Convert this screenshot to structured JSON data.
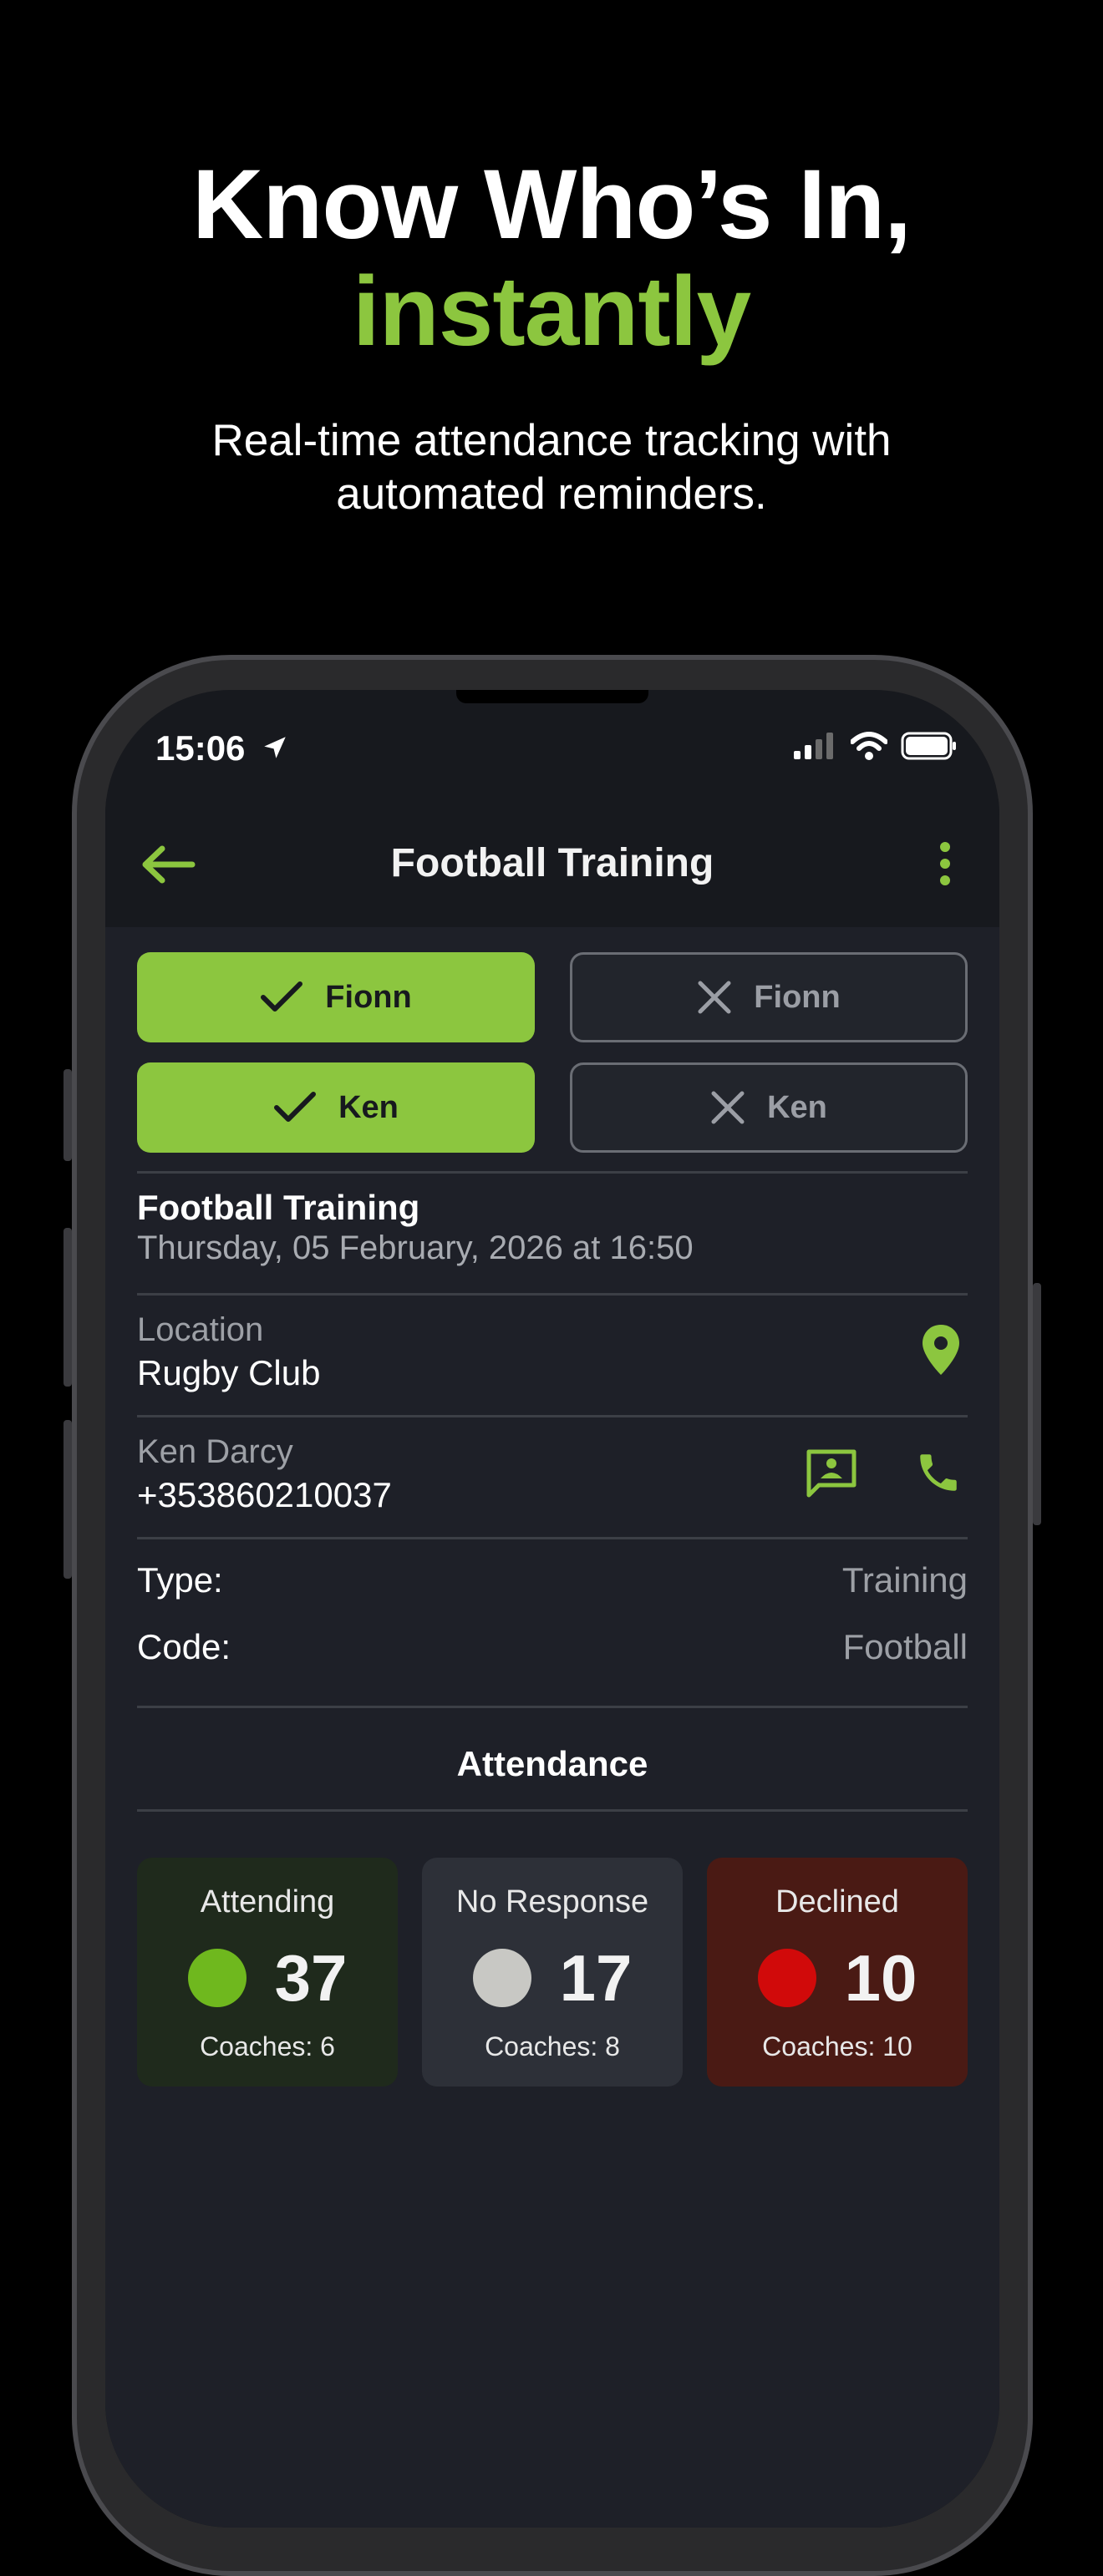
{
  "hero": {
    "title_line1": "Know Who’s In,",
    "title_line2": "instantly",
    "subtitle_line1": "Real-time attendance tracking with",
    "subtitle_line2": "automated reminders."
  },
  "status_bar": {
    "time": "15:06"
  },
  "app_bar": {
    "title": "Football Training",
    "back_icon": "arrow-left-icon",
    "menu_icon": "more-vertical-icon"
  },
  "responses": [
    {
      "accept_label": "Fionn",
      "decline_label": "Fionn"
    },
    {
      "accept_label": "Ken",
      "decline_label": "Ken"
    }
  ],
  "event": {
    "title": "Football Training",
    "datetime": "Thursday, 05 February, 2026 at 16:50",
    "location_label": "Location",
    "location_value": "Rugby Club",
    "contact_name": "Ken Darcy",
    "contact_phone": "+353860210037",
    "type_label": "Type:",
    "type_value": "Training",
    "code_label": "Code:",
    "code_value": "Football"
  },
  "attendance": {
    "heading": "Attendance",
    "cards": [
      {
        "label": "Attending",
        "count": "37",
        "coaches": "Coaches: 6",
        "dot_color": "#6fb81e",
        "bg": "#1f2a1c"
      },
      {
        "label": "No Response",
        "count": "17",
        "coaches": "Coaches: 8",
        "dot_color": "#c8c8c4",
        "bg": "#2d3038"
      },
      {
        "label": "Declined",
        "count": "10",
        "coaches": "Coaches: 10",
        "dot_color": "#d10a0a",
        "bg": "#4a1a14"
      }
    ]
  },
  "colors": {
    "accent": "#8cc63f",
    "background": "#000000",
    "screen": "#1e2028"
  }
}
